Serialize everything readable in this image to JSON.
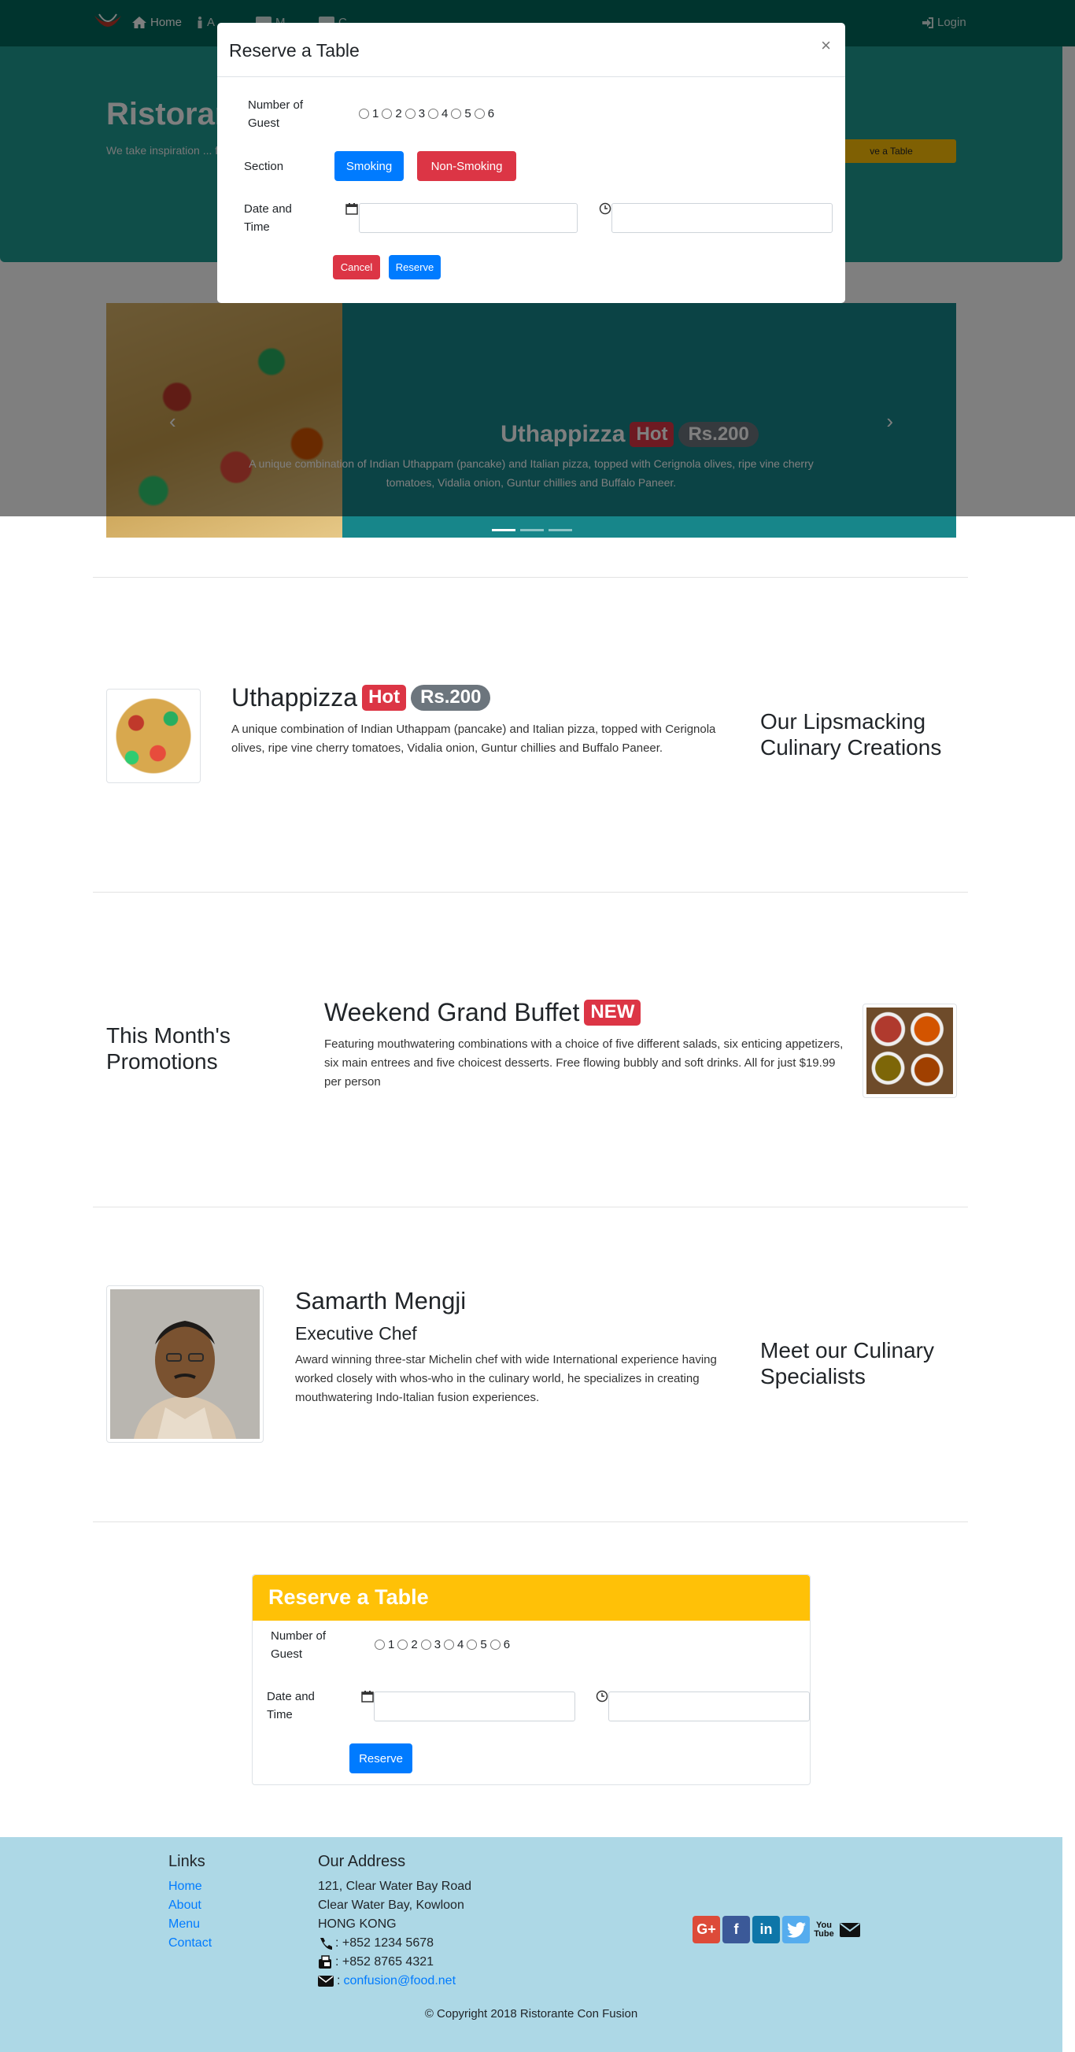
{
  "nav": {
    "items": [
      {
        "label": "Home",
        "icon": "home-icon"
      },
      {
        "label": "A",
        "icon": "info-icon"
      },
      {
        "label": "M",
        "icon": "list-icon"
      },
      {
        "label": "C",
        "icon": "address-card-icon"
      }
    ],
    "login": "Login"
  },
  "jumbotron": {
    "title": "Ristoran",
    "text": "We take inspiration ... fusion experience. C... senses!",
    "reserve_button": "ve a Table"
  },
  "carousel": {
    "title": "Uthappizza",
    "badge": "Hot",
    "price": "Rs.200",
    "desc": "A unique combination of Indian Uthappam (pancake) and Italian pizza, topped with Cerignola olives, ripe vine cherry tomatoes, Vidalia onion, Guntur chillies and Buffalo Paneer."
  },
  "modal": {
    "title": "Reserve a Table",
    "close": "×",
    "guests_label": "Number of Guest",
    "guest_options": [
      "1",
      "2",
      "3",
      "4",
      "5",
      "6"
    ],
    "section_label": "Section",
    "smoking": "Smoking",
    "non_smoking": "Non-Smoking",
    "datetime_label": "Date and Time",
    "cancel": "Cancel",
    "reserve": "Reserve"
  },
  "dish": {
    "title": "Uthappizza",
    "badge": "Hot",
    "price": "Rs.200",
    "desc": "A unique combination of Indian Uthappam (pancake) and Italian pizza, topped with Cerignola olives, ripe vine cherry tomatoes, Vidalia onion, Guntur chillies and Buffalo Paneer.",
    "side_heading": "Our Lipsmacking Culinary Creations"
  },
  "promo": {
    "side_heading": "This Month's Promotions",
    "title": "Weekend Grand Buffet",
    "badge": "NEW",
    "desc": "Featuring mouthwatering combinations with a choice of five different salads, six enticing appetizers, six main entrees and five choicest desserts. Free flowing bubbly and soft drinks. All for just $19.99 per person"
  },
  "leader": {
    "name": "Samarth Mengji",
    "designation": "Executive Chef",
    "desc": "Award winning three-star Michelin chef with wide International experience having worked closely with whos-who in the culinary world, he specializes in creating mouthwatering Indo-Italian fusion experiences.",
    "side_heading": "Meet our Culinary Specialists"
  },
  "reserve_card": {
    "title": "Reserve a Table",
    "guests_label": "Number of Guest",
    "guest_options": [
      "1",
      "2",
      "3",
      "4",
      "5",
      "6"
    ],
    "datetime_label": "Date and Time",
    "reserve": "Reserve"
  },
  "footer": {
    "links_heading": "Links",
    "links": [
      "Home",
      "About",
      "Menu",
      "Contact"
    ],
    "address_heading": "Our Address",
    "address": [
      "121, Clear Water Bay Road",
      "Clear Water Bay, Kowloon",
      "HONG KONG"
    ],
    "phone": ": +852 1234 5678",
    "fax": ": +852 8765 4321",
    "email_prefix": ":",
    "email": "confusion@food.net",
    "social": [
      "google-plus-icon",
      "facebook-icon",
      "linkedin-icon",
      "twitter-icon",
      "youtube-icon",
      "mail-icon"
    ],
    "copyright": "© Copyright 2018 Ristorante Con Fusion"
  },
  "colors": {
    "navbar": "#00695c",
    "jumbotron": "#1e9c93",
    "primary": "#007bff",
    "danger": "#dc3545",
    "warning": "#ffc107",
    "footer": "#add8e6"
  }
}
